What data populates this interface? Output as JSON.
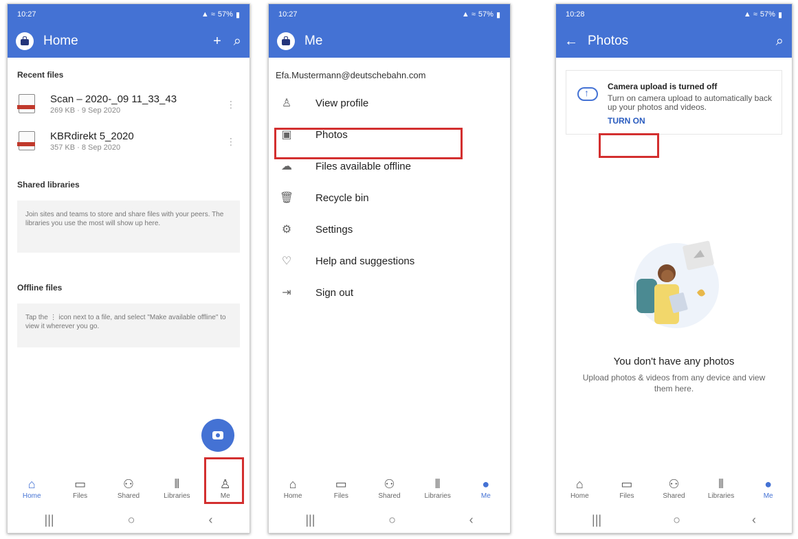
{
  "screen1": {
    "status_time": "10:27",
    "status_right": "57%",
    "title": "Home",
    "recent_header": "Recent files",
    "files": [
      {
        "name": "Scan – 2020-_09 11_33_43",
        "meta": "269 KB · 9 Sep 2020"
      },
      {
        "name": "KBRdirekt 5_2020",
        "meta": "357 KB · 8 Sep 2020"
      }
    ],
    "shared_header": "Shared libraries",
    "shared_text": "Join sites and teams to store and share files with your peers. The libraries you use the most will show up here.",
    "offline_header": "Offline files",
    "offline_text": "Tap the ⋮ icon next to a file, and select \"Make available offline\" to view it wherever you go."
  },
  "screen2": {
    "status_time": "10:27",
    "status_right": "57%",
    "title": "Me",
    "email": "Efa.Mustermann@deutschebahn.com",
    "menu": [
      {
        "label": "View profile",
        "icon": "person-icon"
      },
      {
        "label": "Photos",
        "icon": "image-icon"
      },
      {
        "label": "Files available offline",
        "icon": "cloud-download-icon"
      },
      {
        "label": "Recycle bin",
        "icon": "trash-icon"
      },
      {
        "label": "Settings",
        "icon": "gear-icon"
      },
      {
        "label": "Help and suggestions",
        "icon": "lightbulb-icon"
      },
      {
        "label": "Sign out",
        "icon": "sign-out-icon"
      }
    ]
  },
  "screen3": {
    "status_time": "10:28",
    "status_right": "57%",
    "title": "Photos",
    "banner_title": "Camera upload is turned off",
    "banner_desc": "Turn on camera upload to automatically back up your photos and videos.",
    "banner_button": "TURN ON",
    "empty_title": "You don't have any photos",
    "empty_desc": "Upload photos & videos from any device and view them here."
  },
  "nav": [
    "Home",
    "Files",
    "Shared",
    "Libraries",
    "Me"
  ],
  "colors": {
    "accent": "#4472d4",
    "highlight": "#d32f2f"
  }
}
